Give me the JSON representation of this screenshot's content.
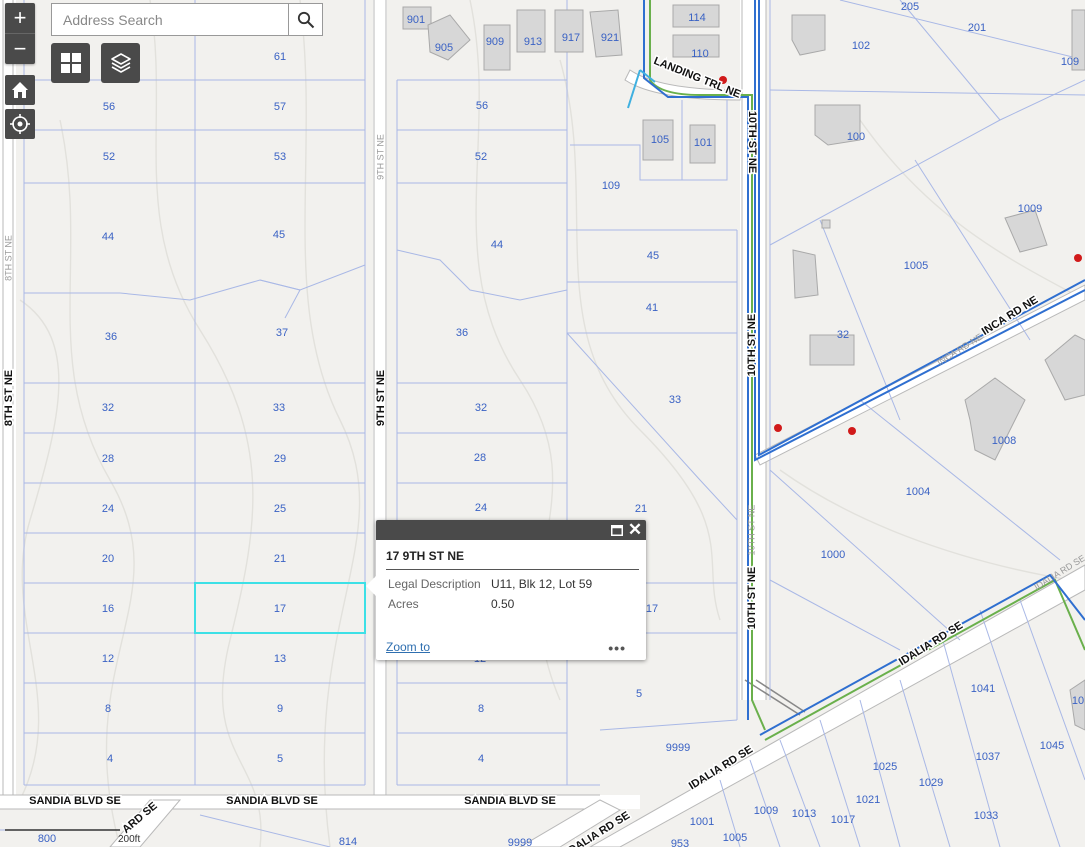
{
  "search": {
    "placeholder": "Address Search"
  },
  "controls": {
    "zoom_in": "+",
    "zoom_out": "−",
    "icons": [
      "search-icon",
      "basemap-grid-icon",
      "layers-icon",
      "home-icon",
      "locate-icon",
      "maximize-icon",
      "close-icon"
    ]
  },
  "popup": {
    "title": "17 9TH ST NE",
    "fields": [
      {
        "label": "Legal Description",
        "value": "U11, Blk 12, Lot 59"
      },
      {
        "label": "Acres",
        "value": "0.50"
      }
    ],
    "zoom_link": "Zoom to",
    "more": "•••",
    "close": "✕"
  },
  "map": {
    "colors": {
      "background": "#f2f1ee",
      "parcel_line": "#a9b8e6",
      "parcel_label": "#3a62c4",
      "road": "#ffffff",
      "road_edge": "#b9b9b9",
      "water_line": "#2f6fd0",
      "sewer_line": "#6ab04c",
      "building": "#d7d7d7",
      "hydrant": "#d11a1a",
      "selection": "#3de0e6"
    },
    "parcel_labels": [
      "61",
      "56",
      "57",
      "52",
      "53",
      "44",
      "45",
      "36",
      "37",
      "32",
      "33",
      "28",
      "29",
      "24",
      "25",
      "20",
      "21",
      "16",
      "17",
      "12",
      "13",
      "8",
      "9",
      "4",
      "5",
      "56",
      "52",
      "44",
      "36",
      "32",
      "28",
      "24",
      "8",
      "4",
      "109",
      "45",
      "41",
      "33",
      "21",
      "17",
      "5",
      "9999",
      "12",
      "901",
      "905",
      "909",
      "913",
      "917",
      "921",
      "114",
      "110",
      "105",
      "101",
      "205",
      "201",
      "102",
      "109",
      "100",
      "1009",
      "1005",
      "32",
      "1008",
      "1004",
      "1000",
      "1041",
      "1045",
      "1037",
      "1025",
      "1029",
      "1033",
      "1021",
      "1017",
      "1013",
      "1009",
      "1005",
      "1001",
      "953",
      "10",
      "800",
      "814",
      "9999"
    ],
    "road_labels": [
      "LANDING TRL NE",
      "10TH ST NE",
      "10TH ST NE",
      "10TH ST NE",
      "INCA RD NE",
      "IDALIA RD SE",
      "IDALIA RD SE",
      "9TH ST NE",
      "8TH ST NE",
      "SANDIA BLVD SE",
      "SANDIA BLVD SE",
      "SANDIA BLVD SE",
      "IDALIA RD SE",
      "ARD SE",
      "8TH ST NE",
      "9TH ST NE",
      "10TH ST NE",
      "INCA RD NE",
      "IDALIA RD SE"
    ],
    "scale": "200ft"
  }
}
